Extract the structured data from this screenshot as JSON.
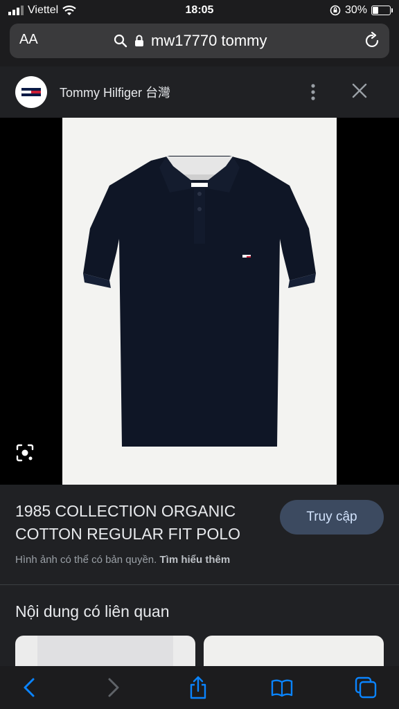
{
  "status_bar": {
    "carrier": "Viettel",
    "time": "18:05",
    "battery": "30%"
  },
  "address_bar": {
    "text_size_label": "AA",
    "query": "mw17770 tommy"
  },
  "site": {
    "title": "Tommy Hilfiger 台灣"
  },
  "product": {
    "title": "1985 COLLECTION ORGANIC COTTON REGULAR FIT POLO",
    "visit_label": "Truy cập"
  },
  "copyright": {
    "text": "Hình ảnh có thể có bản quyền.",
    "learn_more": "Tìm hiểu thêm"
  },
  "related": {
    "heading": "Nội dung có liên quan"
  },
  "icons": {
    "signal": "signal-icon",
    "wifi": "wifi-icon",
    "battery": "battery-icon",
    "search": "search-icon",
    "lock": "lock-icon",
    "reload": "reload-icon",
    "more": "more-vert-icon",
    "close": "close-icon",
    "lens": "lens-icon",
    "back": "back-icon",
    "forward": "forward-icon",
    "share": "share-icon",
    "bookmarks": "bookmarks-icon",
    "tabs": "tabs-icon"
  },
  "colors": {
    "background": "#202124",
    "accent_button": "#3c4a60",
    "toolbar_blue": "#0a84ff",
    "polo_navy": "#0f1626"
  }
}
